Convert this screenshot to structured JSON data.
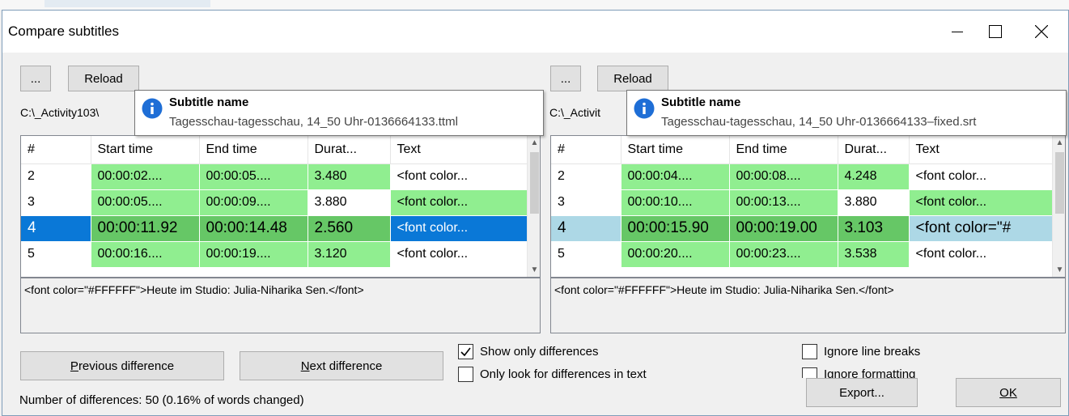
{
  "window": {
    "title": "Compare subtitles"
  },
  "left": {
    "browse_label": "...",
    "reload_label": "Reload",
    "path": "C:\\_Activity103\\",
    "tooltip": {
      "title": "Subtitle name",
      "text": "Tagesschau-tagesschau, 14_50 Uhr-0136664133.ttml"
    },
    "columns": [
      "#",
      "Start time",
      "End time",
      "Durat...",
      "Text"
    ],
    "rows": [
      [
        "2",
        "00:00:02....",
        "00:00:05....",
        "3.480",
        "<font color..."
      ],
      [
        "3",
        "00:00:05....",
        "00:00:09....",
        "3.880",
        "<font color..."
      ],
      [
        "4",
        "00:00:11.92",
        "00:00:14.48",
        "2.560",
        "<font color..."
      ],
      [
        "5",
        "00:00:16....",
        "00:00:19....",
        "3.120",
        "<font color..."
      ]
    ],
    "detail": "<font color=\"#FFFFFF\">Heute im Studio: Julia-Niharika Sen.</font>"
  },
  "right": {
    "browse_label": "...",
    "reload_label": "Reload",
    "path": "C:\\_Activit",
    "tooltip": {
      "title": "Subtitle name",
      "text": "Tagesschau-tagesschau, 14_50 Uhr-0136664133–fixed.srt"
    },
    "columns": [
      "#",
      "Start time",
      "End time",
      "Durat...",
      "Text"
    ],
    "rows": [
      [
        "2",
        "00:00:04....",
        "00:00:08....",
        "4.248",
        "<font color..."
      ],
      [
        "3",
        "00:00:10....",
        "00:00:13....",
        "3.880",
        "<font color..."
      ],
      [
        "4",
        "00:00:15.90",
        "00:00:19.00",
        "3.103",
        "<font color=\"#"
      ],
      [
        "5",
        "00:00:20....",
        "00:00:23....",
        "3.538",
        "<font color..."
      ]
    ],
    "detail": "<font color=\"#FFFFFF\">Heute im Studio: Julia-Niharika Sen.</font>"
  },
  "buttons": {
    "previous_first": "P",
    "previous_rest": "revious difference",
    "next_first": "N",
    "next_rest": "ext difference",
    "export": "Export...",
    "ok": "OK"
  },
  "options": {
    "show_only_differences": "Show only differences",
    "only_text_differences": "Only look for differences in text",
    "ignore_line_breaks": "Ignore line breaks",
    "ignore_formatting": "Ignore formatting"
  },
  "status": "Number of differences: 50 (0.16% of words changed)",
  "colors": {
    "diff_light": "#90ee90",
    "diff_dark": "#66c766",
    "selected": "#0a78d7",
    "selected_inactive": "#add8e6"
  },
  "icons": {
    "tooltip": "info-icon",
    "minimize": "minimize-icon",
    "maximize": "maximize-icon",
    "close": "close-icon",
    "scroll_up": "chevron-up-icon",
    "scroll_down": "chevron-down-icon",
    "checked": "checkmark-icon"
  }
}
